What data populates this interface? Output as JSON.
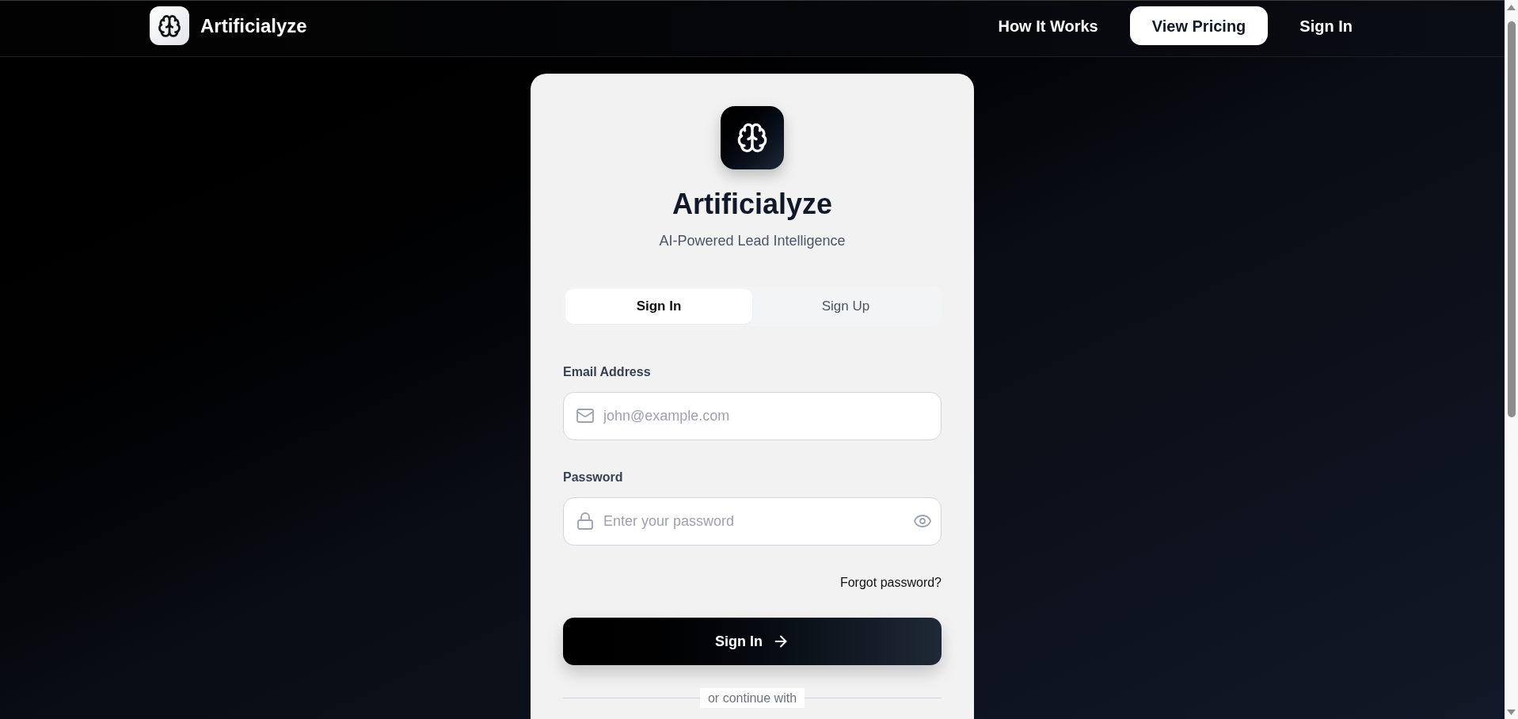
{
  "header": {
    "brand": "Artificialyze",
    "nav": [
      {
        "label": "How It Works",
        "kind": "link"
      },
      {
        "label": "View Pricing",
        "kind": "button"
      },
      {
        "label": "Sign In",
        "kind": "link"
      }
    ]
  },
  "card": {
    "title": "Artificialyze",
    "subtitle": "AI-Powered Lead Intelligence",
    "tabs": [
      {
        "label": "Sign In",
        "selected": true
      },
      {
        "label": "Sign Up",
        "selected": false
      }
    ],
    "fields": [
      {
        "kind": "email",
        "label": "Email Address",
        "placeholder": "john@example.com"
      },
      {
        "kind": "password",
        "label": "Password",
        "placeholder": "Enter your password"
      }
    ],
    "forgot_link": "Forgot password?",
    "submit_button": "Sign In",
    "divider_text": "or continue with"
  }
}
